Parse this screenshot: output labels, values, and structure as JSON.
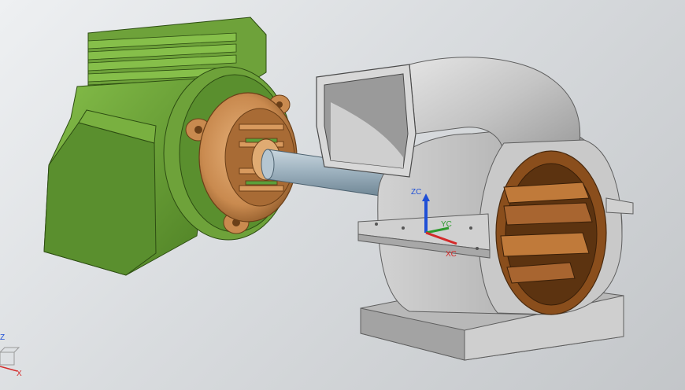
{
  "viewport": {
    "background_top": "#eef0f2",
    "background_bottom": "#c3c6c9"
  },
  "colors": {
    "motor_green": "#5a8f2e",
    "motor_green_light": "#79b040",
    "motor_green_dark": "#3f6a1d",
    "flange_copper": "#c98a4f",
    "flange_copper_dark": "#8f5a2a",
    "shaft_steel": "#8fa6b5",
    "housing_gray": "#bfbfbf",
    "housing_gray_dark": "#8c8c8c",
    "interior_brown": "#8a4e1c",
    "axis_z": "#1f4fd6",
    "axis_y": "#2e9a2e",
    "axis_x": "#d42a2a"
  },
  "triad": {
    "z_label": "ZC",
    "y_label": "YC",
    "x_label": "XC"
  },
  "view_triad": {
    "x_label": "X",
    "z_label": "Z"
  }
}
